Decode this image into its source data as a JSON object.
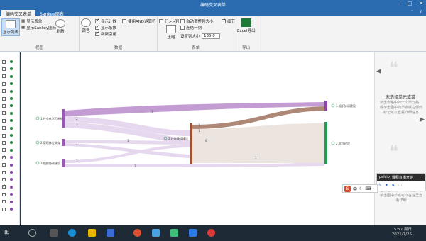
{
  "window": {
    "title": "编码交叉表单"
  },
  "tabs": [
    {
      "label": "编码交叉表单"
    },
    {
      "label": "Sankey图表"
    }
  ],
  "ribbon": {
    "view_group": {
      "label": "视图",
      "show_list": "显示列表",
      "show_form": "显示表单",
      "show_sankey": "显示Sankey图标",
      "refresh": "刷新"
    },
    "data_group": {
      "label": "数据",
      "color": "颜色",
      "show_count": "显示计数",
      "show_coefficient": "显示系数",
      "group_reference": "群聚引用",
      "use_and": "使用AND运算符"
    },
    "form_group": {
      "label": "表单",
      "row_col": "行>>列",
      "compress": "压缩",
      "auto_adjust": "自动调整列大小",
      "wrap": "连结一列",
      "set_col_size": "设置列大小",
      "col_size_value": "135.0",
      "detail": "细节"
    },
    "export_group": {
      "label": "导出",
      "excel": "Excel导出"
    }
  },
  "left_rows": [
    {
      "checked": false,
      "dot": "#1f8a3c"
    },
    {
      "checked": false,
      "dot": "#1f8a3c"
    },
    {
      "checked": false,
      "dot": "#1f8a3c"
    },
    {
      "checked": false,
      "dot": "#1f8a3c"
    },
    {
      "checked": false,
      "dot": "#1f8a3c"
    },
    {
      "checked": false,
      "dot": "#1f8a3c"
    },
    {
      "checked": false,
      "dot": "#1f8a3c"
    },
    {
      "checked": false,
      "dot": "#1f8a3c"
    },
    {
      "checked": false,
      "dot": "#1f8a3c"
    },
    {
      "checked": false,
      "dot": "#1f8a3c"
    },
    {
      "checked": false,
      "dot": "#1f8a3c"
    },
    {
      "checked": false,
      "dot": "#1f8a3c"
    },
    {
      "checked": false,
      "dot": "#1f8a3c"
    },
    {
      "checked": true,
      "dot": "#8e44ad"
    },
    {
      "checked": false,
      "dot": "#8e44ad"
    },
    {
      "checked": false,
      "dot": "#8e44ad"
    },
    {
      "checked": false,
      "dot": "#8e44ad"
    },
    {
      "checked": true,
      "dot": "#8e44ad"
    },
    {
      "checked": false,
      "dot": "#8e44ad"
    },
    {
      "checked": false,
      "dot": "#8e44ad"
    },
    {
      "checked": false,
      "dot": "#8e44ad"
    }
  ],
  "sankey": {
    "left_nodes": [
      "1.社会化学习系统",
      "2.管理体会教育",
      "3.组织协调建设"
    ],
    "middle_node": "2.技能建设建设",
    "right_nodes": [
      "1.组织协调建设",
      "2.学科建设"
    ],
    "link_labels": [
      "1",
      "2",
      "3",
      "1",
      "1",
      "3",
      "1",
      "1",
      "1",
      "6",
      "1"
    ],
    "colors": {
      "left": "#9b59b6",
      "middle": "#a0522d",
      "right_top": "#8e44ad",
      "right_bottom": "#1f9d55",
      "flow": "#e6d8ee",
      "flow_brown": "#ece4de"
    }
  },
  "right_panel": {
    "title": "未选择单元或菜",
    "desc": "单击表格中的一个单元格，或单击图中的节点或右侧的标记可以查看详细信息",
    "desc2": "击表格中的一个单元格，或单击图中节点可以在这里查看详细",
    "arrow_left": "◀",
    "arrow_right": "▶"
  },
  "popup": {
    "title": "课程直播开始",
    "sub": "pelcio"
  },
  "ime": {
    "label": "S",
    "lang": "中"
  },
  "taskbar": {
    "time": "15:57 周日",
    "date": "2021/7/25"
  }
}
